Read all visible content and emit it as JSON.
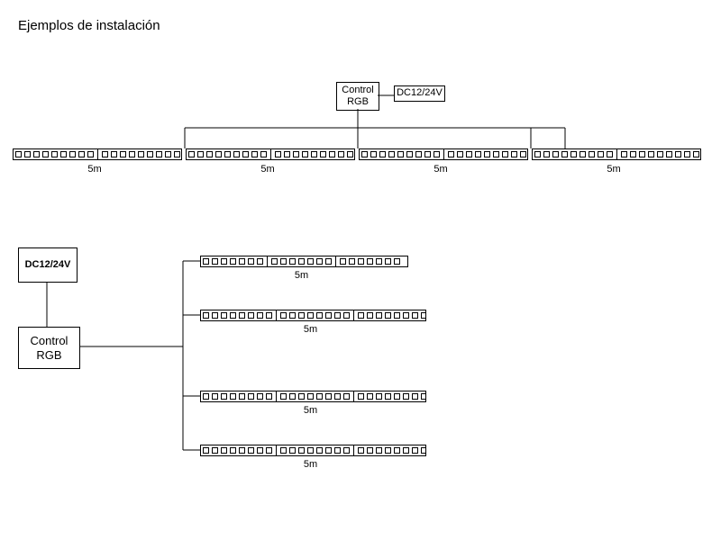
{
  "title": "Ejemplos de instalación",
  "top": {
    "controller": "Control\nRGB",
    "power": "DC12/24V",
    "strips": [
      "5m",
      "5m",
      "5m",
      "5m"
    ]
  },
  "bottom": {
    "power": "DC12/24V",
    "controller": "Control\nRGB",
    "strips": [
      "5m",
      "5m",
      "5m",
      "5m"
    ]
  }
}
